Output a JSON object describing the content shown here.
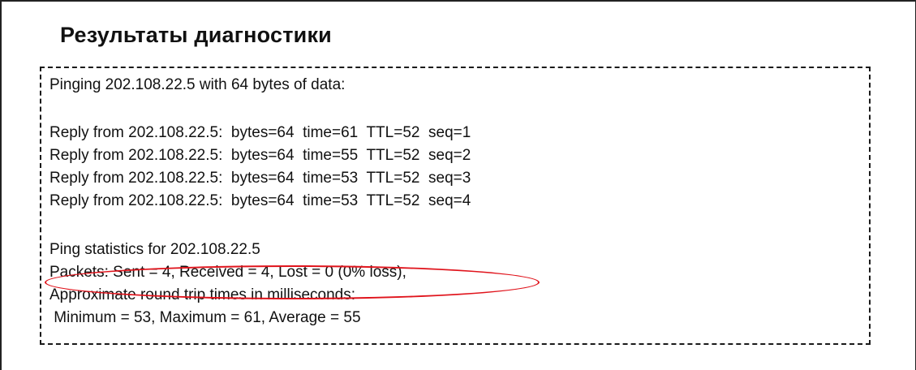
{
  "header": {
    "title": "Результаты диагностики"
  },
  "results": {
    "lines": [
      "Pinging 202.108.22.5 with 64 bytes of data:",
      "Reply from 202.108.22.5:  bytes=64  time=61  TTL=52  seq=1",
      "Reply from 202.108.22.5:  bytes=64  time=55  TTL=52  seq=2",
      "Reply from 202.108.22.5:  bytes=64  time=53  TTL=52  seq=3",
      "Reply from 202.108.22.5:  bytes=64  time=53  TTL=52  seq=4",
      "Ping statistics for 202.108.22.5",
      "Packets: Sent = 4, Received = 4, Lost = 0 (0% loss),",
      "Approximate round trip times in milliseconds:",
      " Minimum = 53, Maximum = 61, Average = 55"
    ]
  },
  "colors": {
    "highlight": "#e0141c",
    "border": "#1a1a1a",
    "text": "#111111"
  }
}
